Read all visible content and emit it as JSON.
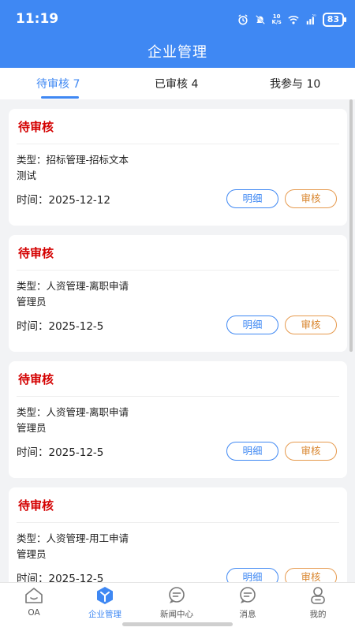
{
  "status_bar": {
    "time": "11:19",
    "net_speed_top": "10",
    "net_speed_bottom": "K/s",
    "signal": "5G",
    "battery": "83"
  },
  "header": {
    "title": "企业管理"
  },
  "tabs": [
    {
      "label": "待审核 7"
    },
    {
      "label": "已审核 4"
    },
    {
      "label": "我参与 10"
    }
  ],
  "cards": [
    {
      "status": "待审核",
      "type": "类型：招标管理-招标文本",
      "user": "测试",
      "time": "时间：2025-12-12",
      "detail_label": "明细",
      "review_label": "审核"
    },
    {
      "status": "待审核",
      "type": "类型：人资管理-离职申请",
      "user": "管理员",
      "time": "时间：2025-12-5",
      "detail_label": "明细",
      "review_label": "审核"
    },
    {
      "status": "待审核",
      "type": "类型：人资管理-离职申请",
      "user": "管理员",
      "time": "时间：2025-12-5",
      "detail_label": "明细",
      "review_label": "审核"
    },
    {
      "status": "待审核",
      "type": "类型：人资管理-用工申请",
      "user": "管理员",
      "time": "时间：2025-12-5",
      "detail_label": "明细",
      "review_label": "审核"
    }
  ],
  "bottom_nav": [
    {
      "label": "OA",
      "icon": "home-icon"
    },
    {
      "label": "企业管理",
      "icon": "enterprise-icon"
    },
    {
      "label": "新闻中心",
      "icon": "chat-icon"
    },
    {
      "label": "消息",
      "icon": "message-icon"
    },
    {
      "label": "我的",
      "icon": "profile-icon"
    }
  ],
  "colors": {
    "primary": "#3f88f3",
    "pending_red": "#d40000",
    "review_orange": "#e69a4e"
  }
}
